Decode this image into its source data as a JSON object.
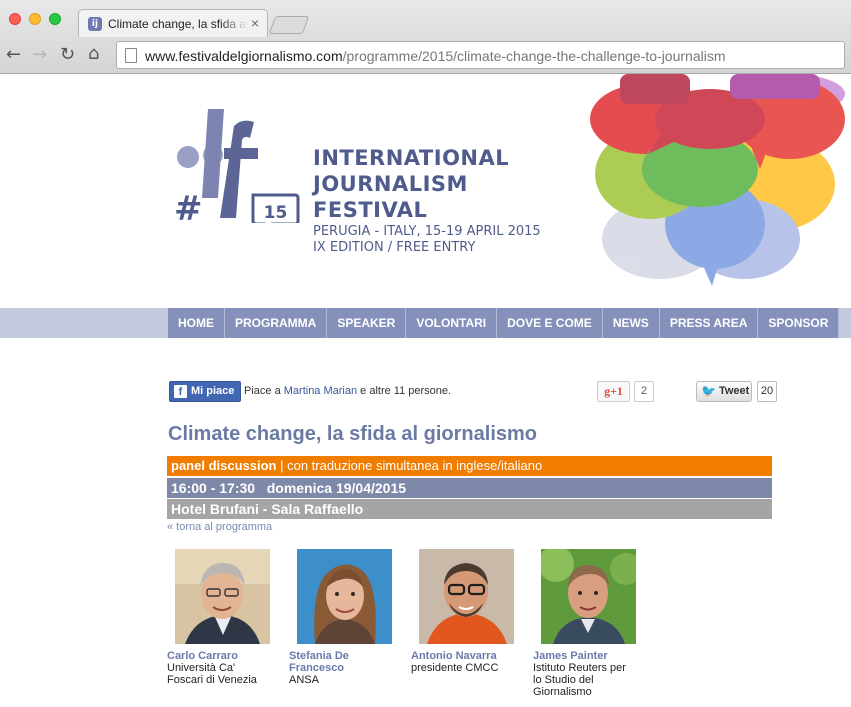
{
  "browser": {
    "tab_title": "Climate change, la sfida al giornalismo",
    "tab_close": "×",
    "url_domain": "www.festivaldelgiornalismo.com",
    "url_path": "/programme/2015/climate-change-the-challenge-to-journalism"
  },
  "logo": {
    "hash": "#",
    "edition_badge": "15"
  },
  "festival": {
    "title_lines": [
      "INTERNATIONAL",
      "JOURNALISM",
      "FESTIVAL"
    ],
    "dates_line": "PERUGIA - ITALY, 15-19 APRIL 2015",
    "edition_line": "IX EDITION / FREE ENTRY"
  },
  "nav": {
    "items": [
      "HOME",
      "PROGRAMMA",
      "SPEAKER",
      "VOLONTARI",
      "DOVE E COME",
      "NEWS",
      "PRESS AREA",
      "SPONSOR"
    ]
  },
  "social": {
    "fb_button": "Mi piace",
    "fb_text_pre": "Piace a ",
    "fb_text_link": "Martina Marian",
    "fb_text_post": " e altre 11 persone.",
    "gplus_label": "g+1",
    "gplus_count": "2",
    "tweet_label": "Tweet",
    "tweet_count": "20"
  },
  "event": {
    "title": "Climate change, la sfida al giornalismo",
    "type": "panel discussion",
    "type_note": " | con traduzione simultanea in inglese/italiano",
    "time": "16:00 - 17:30   domenica 19/04/2015",
    "venue": "Hotel Brufani - Sala Raffaello",
    "back_link": "« torna al programma"
  },
  "speakers": [
    {
      "name_lines": [
        "Carlo Carraro"
      ],
      "role_lines": [
        "Università Ca'",
        "Foscari di Venezia"
      ]
    },
    {
      "name_lines": [
        "Stefania De",
        "Francesco"
      ],
      "role_lines": [
        "ANSA"
      ]
    },
    {
      "name_lines": [
        "Antonio Navarra"
      ],
      "role_lines": [
        "presidente CMCC"
      ]
    },
    {
      "name_lines": [
        "James Painter"
      ],
      "role_lines": [
        "Istituto Reuters per",
        "lo Studio del",
        "Giornalismo"
      ]
    }
  ],
  "colors": {
    "brand_navy": "#4f5b8c",
    "nav_bg": "#8591bb",
    "panel_orange": "#f07c00",
    "time_bar": "#7e88a8",
    "venue_bar": "#a5a5a5"
  }
}
